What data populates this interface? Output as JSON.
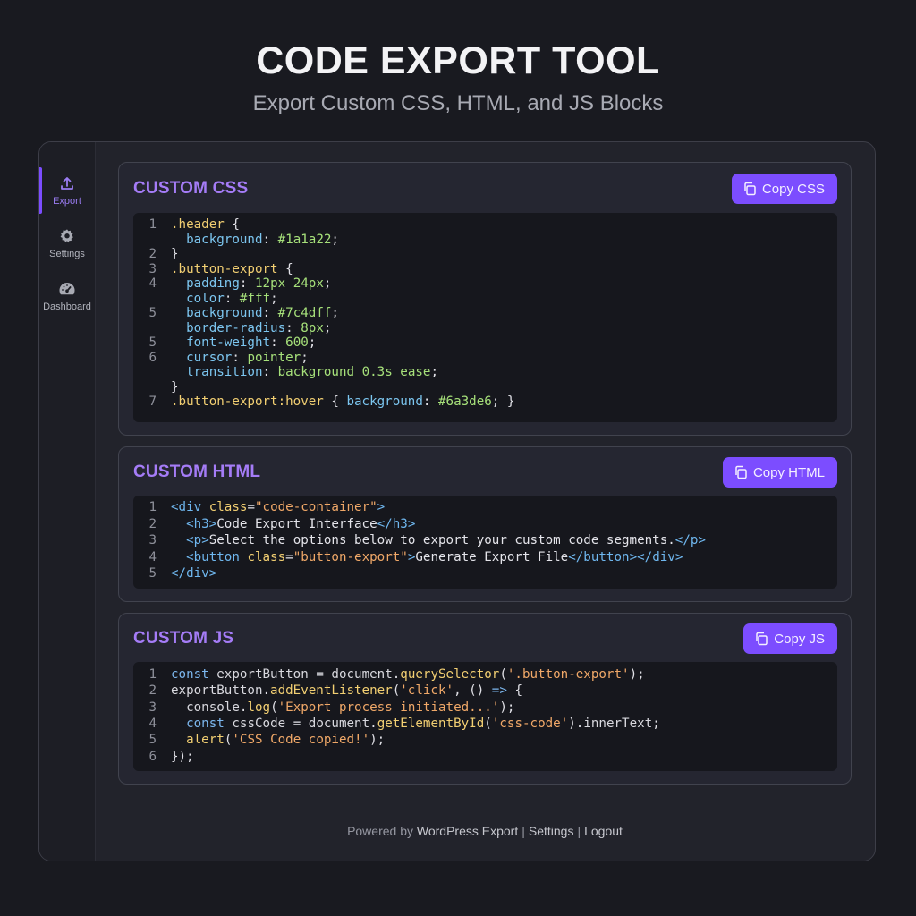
{
  "header": {
    "title": "CODE EXPORT TOOL",
    "subtitle": "Export Custom CSS, HTML, and JS Blocks"
  },
  "sidebar": {
    "items": [
      {
        "label": "Export",
        "icon": "upload-icon",
        "active": true
      },
      {
        "label": "Settings",
        "icon": "gear-icon",
        "active": false
      },
      {
        "label": "Dashboard",
        "icon": "speedometer-icon",
        "active": false
      }
    ]
  },
  "css_card": {
    "title": "CUSTOM CSS",
    "button": "Copy CSS",
    "line_numbers": [
      "1",
      "",
      "2",
      "3",
      "4",
      "",
      "5",
      "",
      "5",
      "6",
      "",
      "",
      "7"
    ],
    "lines": [
      ".header {",
      "  background: #1a1a22;",
      "}",
      ".button-export {",
      "  padding: 12px 24px;",
      "  color: #fff;",
      "  background: #7c4dff;",
      "  border-radius: 8px;",
      "  font-weight: 600;",
      "  cursor: pointer;",
      "  transition: background 0.3s ease;",
      "}",
      ".button-export:hover { background: #6a3de6; }"
    ]
  },
  "html_card": {
    "title": "CUSTOM HTML",
    "button": "Copy HTML",
    "line_numbers": [
      "1",
      "2",
      "3",
      "4",
      "5"
    ],
    "lines": [
      "<div class=\"code-container\">",
      "  <h3>Code Export Interface</h3>",
      "  <p>Select the options below to export your custom code segments.</p>",
      "  <button class=\"button-export\">Generate Export File</button></div>",
      "</div>"
    ]
  },
  "js_card": {
    "title": "CUSTOM JS",
    "button": "Copy JS",
    "line_numbers": [
      "1",
      "2",
      "3",
      "4",
      "5",
      "6"
    ],
    "lines": [
      "const exportButton = document.querySelector('.button-export');",
      "exportButton.addEventListener('click', () => {",
      "  console.log('Export process initiated...');",
      "  const cssCode = document.getElementById('css-code').innerText;",
      "  alert('CSS Code copied!');",
      "});"
    ]
  },
  "footer": {
    "prefix": "Powered by",
    "link1": "WordPress Export",
    "sep1": "|",
    "link2": "Settings",
    "sep2": "|",
    "link3": "Logout"
  },
  "colors": {
    "accent": "#7c4dff",
    "title_purple": "#a57cf7",
    "background": "#191a20"
  }
}
